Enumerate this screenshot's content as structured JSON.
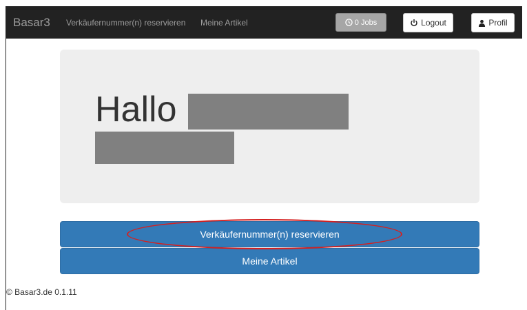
{
  "navbar": {
    "brand": "Basar3",
    "links": [
      "Verkäufernummer(n) reservieren",
      "Meine Artikel"
    ],
    "jobs_label": "0 Jobs",
    "logout_label": "Logout",
    "profile_label": "Profil",
    "icons": {
      "jobs": "clock-icon",
      "logout": "power-icon",
      "profile": "user-icon"
    }
  },
  "jumbotron": {
    "greeting": "Hallo"
  },
  "actions": {
    "reserve_label": "Verkäufernummer(n) reservieren",
    "articles_label": "Meine Artikel"
  },
  "footer": {
    "copyright": "© Basar3.de 0.1.11"
  },
  "colors": {
    "navbar_bg": "#222222",
    "primary": "#337ab7",
    "jumbotron_bg": "#eeeeee",
    "annotation": "#d42020"
  }
}
